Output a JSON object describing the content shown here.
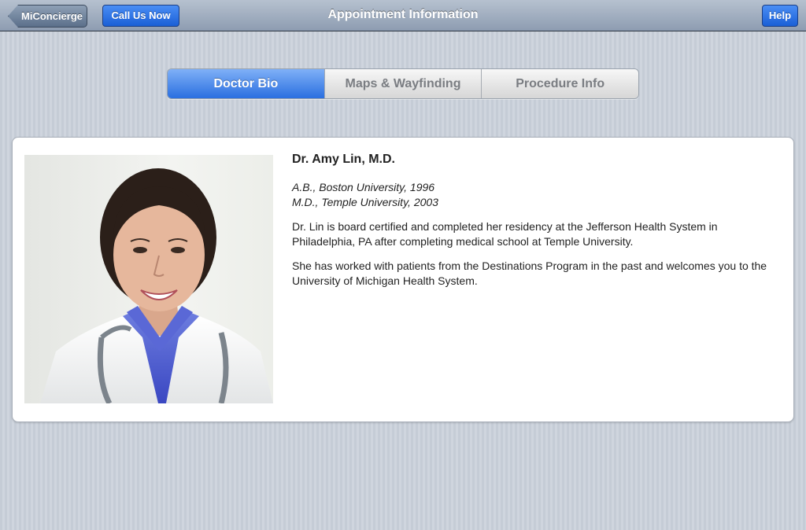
{
  "navbar": {
    "back_label": "MiConcierge",
    "call_label": "Call Us Now",
    "title": "Appointment Information",
    "help_label": "Help"
  },
  "tabs": [
    {
      "label": "Doctor Bio",
      "active": true
    },
    {
      "label": "Maps & Wayfinding",
      "active": false
    },
    {
      "label": "Procedure Info",
      "active": false
    }
  ],
  "doctor": {
    "name": "Dr. Amy Lin, M.D.",
    "degrees": [
      "A.B., Boston University, 1996",
      "M.D., Temple University, 2003"
    ],
    "paragraphs": [
      "Dr. Lin is board certified and completed her residency at the Jefferson Health System in Philadelphia, PA after completing medical school at Temple University.",
      "She has worked with patients from the Destinations Program in the past and welcomes you to the University of Michigan Health System."
    ]
  },
  "colors": {
    "accent_blue": "#2a6fe0",
    "navbar": "#8d9cb1",
    "background": "#c9d0d9"
  }
}
